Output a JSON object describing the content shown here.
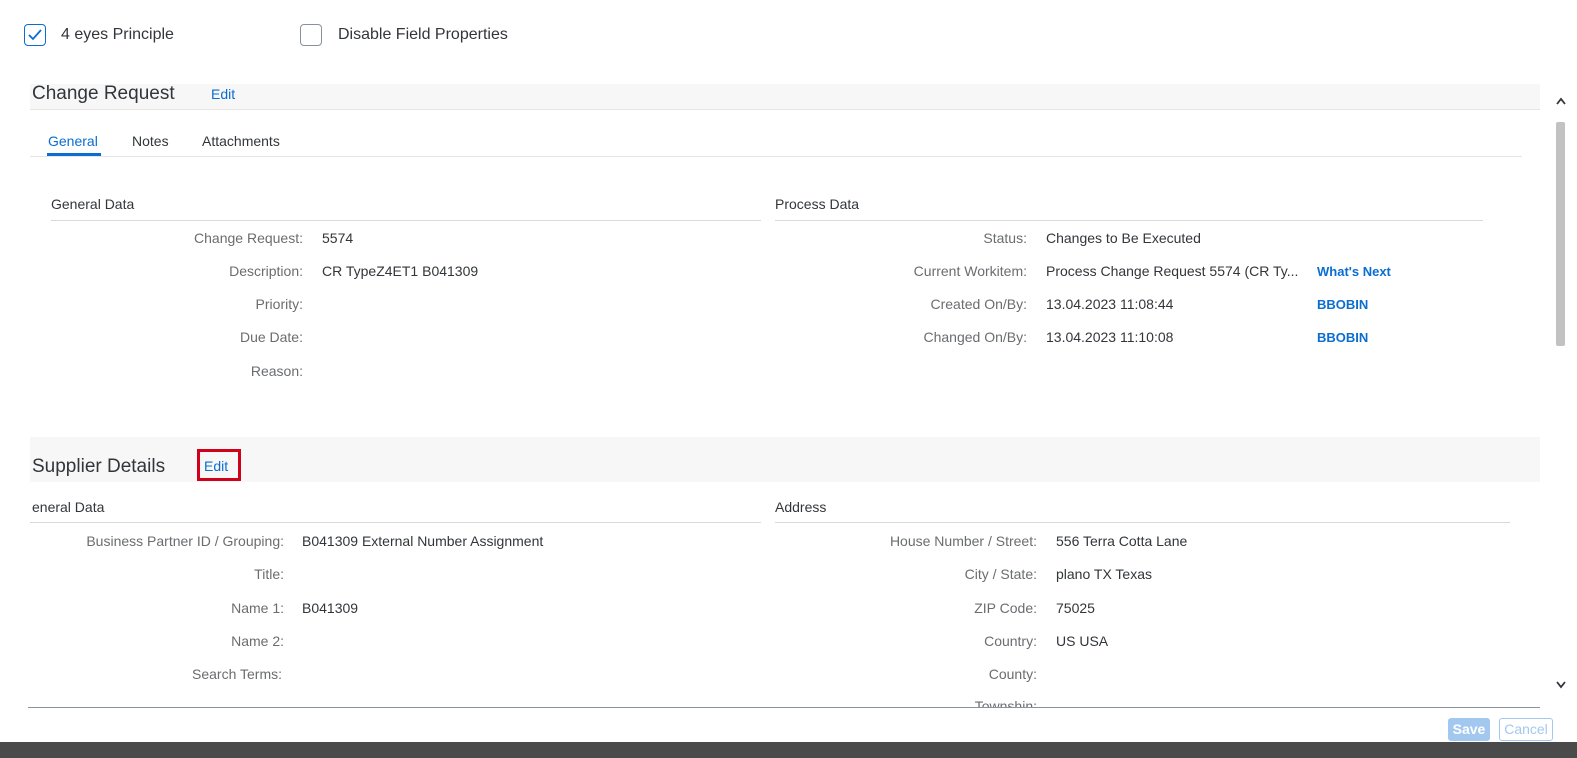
{
  "options": {
    "four_eyes": {
      "label": "4 eyes Principle",
      "checked": true
    },
    "disable_fields": {
      "label": "Disable Field Properties",
      "checked": false
    }
  },
  "change_request": {
    "title": "Change Request",
    "edit_label": "Edit",
    "tabs": [
      {
        "label": "General",
        "active": true
      },
      {
        "label": "Notes",
        "active": false
      },
      {
        "label": "Attachments",
        "active": false
      }
    ],
    "general_data": {
      "title": "General Data",
      "fields": [
        {
          "label": "Change Request:",
          "value": "5574"
        },
        {
          "label": "Description:",
          "value": "CR TypeZ4ET1 B041309"
        },
        {
          "label": "Priority:",
          "value": ""
        },
        {
          "label": "Due Date:",
          "value": ""
        },
        {
          "label": "Reason:",
          "value": ""
        }
      ]
    },
    "process_data": {
      "title": "Process Data",
      "fields": [
        {
          "label": "Status:",
          "value": "Changes to Be Executed",
          "link": ""
        },
        {
          "label": "Current Workitem:",
          "value": "Process Change Request 5574 (CR Ty...",
          "link": "What's Next"
        },
        {
          "label": "Created On/By:",
          "value": "13.04.2023 11:08:44",
          "link": "BBOBIN"
        },
        {
          "label": "Changed On/By:",
          "value": "13.04.2023 11:10:08",
          "link": "BBOBIN"
        }
      ]
    }
  },
  "supplier_details": {
    "title": "Supplier Details",
    "edit_label": "Edit",
    "general_data": {
      "title": "eneral Data",
      "fields": [
        {
          "label": "Business Partner ID / Grouping:",
          "value": "B041309 External Number Assignment"
        },
        {
          "label": "Title:",
          "value": ""
        },
        {
          "label": "Name 1:",
          "value": "B041309"
        },
        {
          "label": "Name 2:",
          "value": ""
        },
        {
          "label": "Search Terms:",
          "value": ""
        }
      ]
    },
    "address": {
      "title": "Address",
      "fields": [
        {
          "label": "House Number / Street:",
          "value": "556 Terra Cotta Lane"
        },
        {
          "label": "City / State:",
          "value": "plano TX Texas"
        },
        {
          "label": "ZIP Code:",
          "value": "75025"
        },
        {
          "label": "Country:",
          "value": "US USA"
        },
        {
          "label": "County:",
          "value": ""
        },
        {
          "label": "Townshin:",
          "value": ""
        }
      ]
    }
  },
  "footer": {
    "save_label": "Save",
    "cancel_label": "Cancel"
  },
  "colors": {
    "accent": "#0a6ed1",
    "highlight_box": "#d0021b"
  }
}
